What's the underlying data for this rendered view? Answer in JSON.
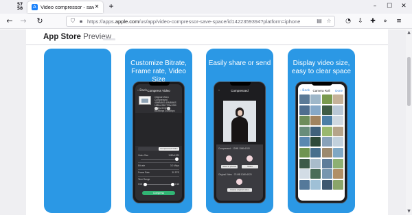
{
  "browser": {
    "app_badge": "57\n58",
    "tab_title": "Video compressor - save space",
    "new_tab_glyph": "+",
    "window_controls": [
      "–",
      "☐",
      "✕"
    ],
    "url_prefix": "https://apps.",
    "url_domain": "apple.com",
    "url_path": "/us/app/video-compressor-save-space/id1422359394?platform=iphone",
    "nav_back_glyph": "←",
    "nav_forward_glyph": "→",
    "reload_glyph": "↻"
  },
  "page": {
    "brand_bold": "App Store",
    "brand_light": " Preview",
    "screenshots": [
      {
        "caption": ""
      },
      {
        "caption": "Customize Bitrate,\nFrame rate, Video Size"
      },
      {
        "caption": "Easily share or send"
      },
      {
        "caption": "Display video size,\neasy to clear space"
      }
    ]
  },
  "compress_screen": {
    "back": "‹ Back",
    "title": "Compress Video",
    "meta": "Original Video    Compressed\n40MB/60S     40MB/60S\n1080x1920    720x1280\n30 fps        30 fps\n6200kbps     2400kbps",
    "tabs": [
      "",
      "Compressed Video"
    ],
    "rows": [
      {
        "label": "Video Size",
        "value": "1080x1920"
      },
      {
        "label": "Bit rate",
        "value": "3.0 Mbps"
      },
      {
        "label": "Frame Rate",
        "value": "30 FPS"
      },
      {
        "label": "Time Range",
        "value": ""
      }
    ],
    "range_start": "0:00",
    "range_end": "0:15",
    "button": "Compress"
  },
  "share_screen": {
    "back": "‹",
    "title": "Compressed",
    "info_top": "Compressed  · 12MB  1080x1920",
    "save_chip": "Save to photos",
    "share_chip": "Share",
    "info_bottom": "Original Video · 75 MB  1080x1920",
    "delete_chip": "Delete original video"
  },
  "roll_screen": {
    "back": "‹ Back",
    "title": "Camera Roll",
    "right": "Done",
    "tile_colors": [
      "#5b7a97",
      "#9eb7c9",
      "#7a9a4e",
      "#c5b299",
      "#4f6e8f",
      "#86a8c7",
      "#3f5c46",
      "#b9c8d6",
      "#6d8d5a",
      "#a1835f",
      "#4c7fa6",
      "#cfd9e1",
      "#688d7a",
      "#41617b",
      "#9ab86e",
      "#b5a48a",
      "#5a88b0",
      "#2f4a3a",
      "#88a2b9",
      "#c2d1dc",
      "#6f9450",
      "#476f8d",
      "#9c8a6e",
      "#7fa8c4",
      "#3c5a48",
      "#a9bccb",
      "#5e7d9a",
      "#8db073",
      "#d2dce5",
      "#4a6d58",
      "#7796ae",
      "#b08f66",
      "#55799a",
      "#9fc0d6",
      "#3e5870",
      "#8aa56a",
      "#c9d6df",
      "#627f95",
      "#4a7a5c",
      "#a6b7c5",
      "#6f8fa9",
      "#93b37c",
      "#4b6a85",
      "#b6c5d1"
    ]
  }
}
